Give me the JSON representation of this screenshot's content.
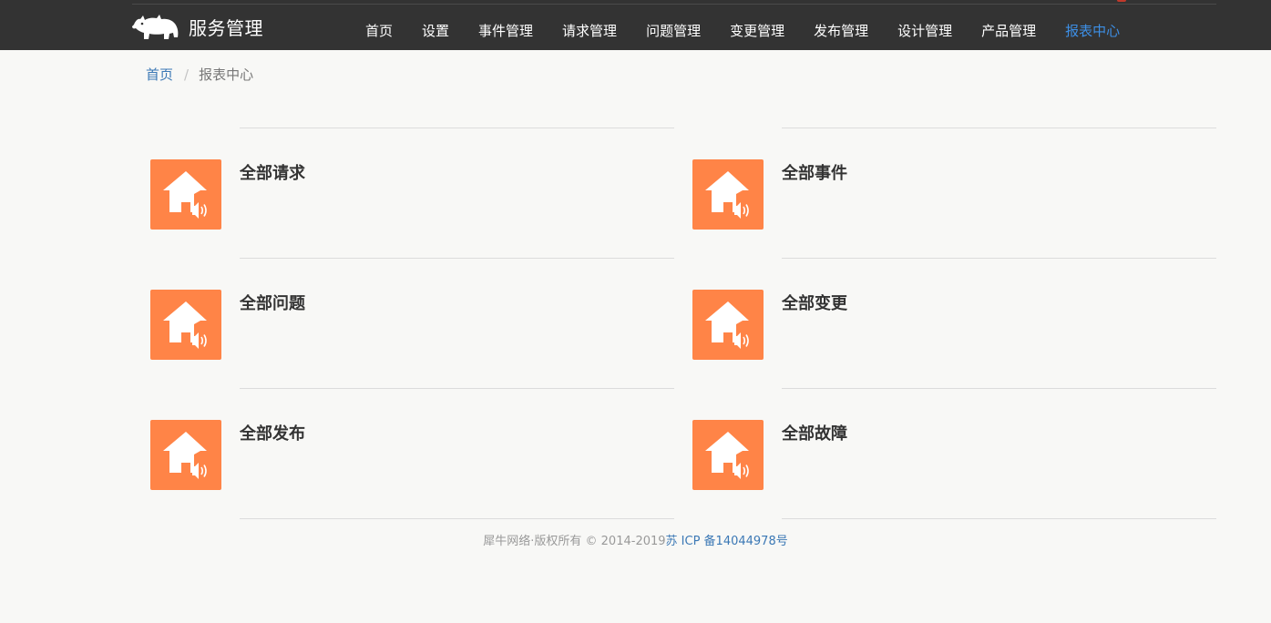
{
  "header": {
    "brand_name": "服务管理",
    "nav": [
      {
        "label": "首页",
        "active": false
      },
      {
        "label": "设置",
        "active": false
      },
      {
        "label": "事件管理",
        "active": false
      },
      {
        "label": "请求管理",
        "active": false
      },
      {
        "label": "问题管理",
        "active": false
      },
      {
        "label": "变更管理",
        "active": false
      },
      {
        "label": "发布管理",
        "active": false
      },
      {
        "label": "设计管理",
        "active": false
      },
      {
        "label": "产品管理",
        "active": false
      },
      {
        "label": "报表中心",
        "active": true
      }
    ]
  },
  "breadcrumb": {
    "home": "首页",
    "separator": "/",
    "current": "报表中心"
  },
  "reports": [
    {
      "title": "全部请求",
      "icon": "house-speaker-icon"
    },
    {
      "title": "全部事件",
      "icon": "house-speaker-icon"
    },
    {
      "title": "全部问题",
      "icon": "house-speaker-icon"
    },
    {
      "title": "全部变更",
      "icon": "house-speaker-icon"
    },
    {
      "title": "全部发布",
      "icon": "house-speaker-icon"
    },
    {
      "title": "全部故障",
      "icon": "house-speaker-icon"
    }
  ],
  "footer": {
    "copyright": "犀牛网络·版权所有 © 2014-2019",
    "icp": "苏 ICP 备14044978号"
  },
  "colors": {
    "header_bg": "#333333",
    "accent": "#3d8fe6",
    "icon_bg": "#ff8447",
    "link": "#3b78b5",
    "page_bg": "#f8f8f6"
  }
}
